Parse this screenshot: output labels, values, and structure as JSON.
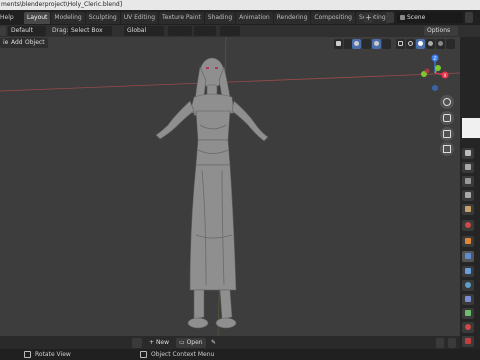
{
  "window": {
    "title": "ments\\blenderproject\\Holy_Cleric.blend]"
  },
  "topbar": {
    "menu_label": "Help",
    "tabs": [
      {
        "label": "Layout",
        "active": true
      },
      {
        "label": "Modeling"
      },
      {
        "label": "Sculpting"
      },
      {
        "label": "UV Editing"
      },
      {
        "label": "Texture Paint"
      },
      {
        "label": "Shading"
      },
      {
        "label": "Animation"
      },
      {
        "label": "Rendering"
      },
      {
        "label": "Compositing"
      },
      {
        "label": "Scripting"
      }
    ],
    "add_tab": "+",
    "scene_name": "Scene"
  },
  "header": {
    "orientation_value": "Default",
    "drag_label": "Drag:",
    "drag_value": "Select Box",
    "transform_value": "Global",
    "options_label": "Options"
  },
  "toolbar": {
    "view": "iew",
    "add": "Add",
    "object": "Object"
  },
  "bottombar": {
    "new_label": "New",
    "open_label": "Open"
  },
  "statusbar": {
    "left_hint": "Rotate View",
    "right_hint": "Object Context Menu"
  },
  "gizmo": {
    "x_label": "X",
    "y_label": "Y",
    "z_label": "Z"
  },
  "colors": {
    "viewport_bg": "#3d3d3d",
    "active_accent": "#4a6fae",
    "x_axis": "#e8344a",
    "y_axis": "#7ec733",
    "z_axis": "#3c7ff0",
    "grid_red": "#9b4a4a",
    "grid_green": "#6b8a3a"
  }
}
